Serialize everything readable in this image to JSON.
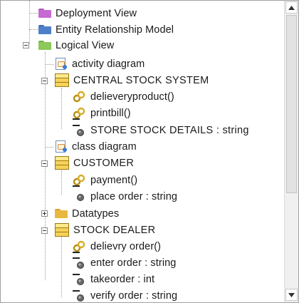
{
  "tree": {
    "items": [
      {
        "label": "Deployment View",
        "icon": "deployment-view-folder-icon"
      },
      {
        "label": "Entity Relationship Model",
        "icon": "entity-relationship-folder-icon"
      },
      {
        "label": "Logical View",
        "icon": "logical-view-folder-icon"
      },
      {
        "label": "activity diagram",
        "icon": "diagram-icon"
      },
      {
        "label": "CENTRAL STOCK SYSTEM",
        "icon": "class-icon"
      },
      {
        "label": "delieveryproduct()",
        "icon": "operation-icon"
      },
      {
        "label": "printbill()",
        "icon": "operation-icon"
      },
      {
        "label": "STORE STOCK DETAILS : string",
        "icon": "attribute-icon"
      },
      {
        "label": "class diagram",
        "icon": "diagram-icon"
      },
      {
        "label": "CUSTOMER",
        "icon": "class-icon"
      },
      {
        "label": "payment()",
        "icon": "operation-icon"
      },
      {
        "label": "place order : string",
        "icon": "attribute-icon"
      },
      {
        "label": "Datatypes",
        "icon": "datatypes-folder-icon"
      },
      {
        "label": "STOCK DEALER",
        "icon": "class-icon"
      },
      {
        "label": "delievry order()",
        "icon": "operation-icon"
      },
      {
        "label": "enter order : string",
        "icon": "attribute-icon"
      },
      {
        "label": "takeorder : int",
        "icon": "attribute-icon"
      },
      {
        "label": "verify order : string",
        "icon": "attribute-icon"
      }
    ]
  },
  "colors": {
    "deployment_folder": "#c76ad1",
    "er_folder": "#4f7fc9",
    "logical_folder": "#8cc85a",
    "datatypes_folder": "#e8b840",
    "class_fill": "#f7d25a",
    "operation_gear": "#c9a227",
    "attribute_dot": "#606060"
  },
  "scrollbar": {
    "up_icon": "scroll-up-arrow-icon",
    "down_icon": "scroll-down-arrow-icon"
  }
}
